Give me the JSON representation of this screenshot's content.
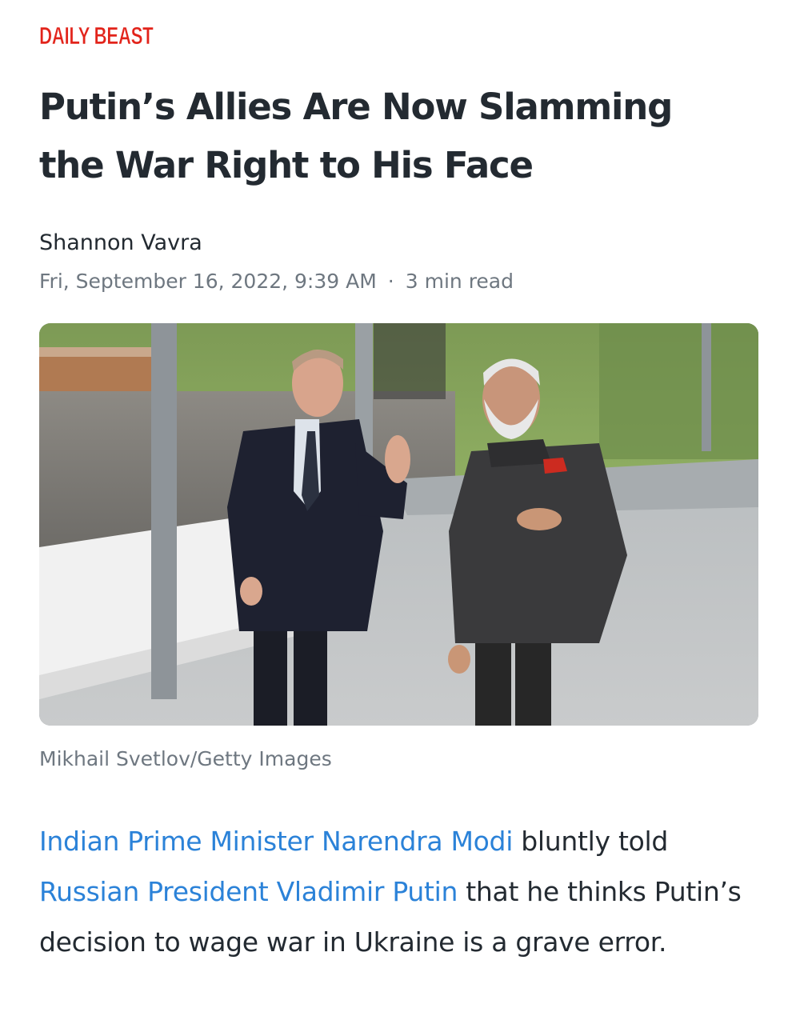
{
  "brand": {
    "logo_text": "DAILY BEAST",
    "color": "#e2231a"
  },
  "article": {
    "headline_line1": "Putin’s Allies Are Now Slamming",
    "headline_line2": "the War Right to His Face",
    "author": "Shannon Vavra",
    "date": "Fri, September 16, 2022, 9:39 AM",
    "separator": "·",
    "read_time": "3 min read",
    "image_caption": "Mikhail Svetlov/Getty Images",
    "body": {
      "link1": "Indian Prime Minister Narendra Modi",
      "text1": " bluntly told ",
      "link2": "Russian President Vladimir Putin",
      "text2": " that he thinks Putin’s decision to wage war in Ukraine is a grave error."
    }
  },
  "colors": {
    "text": "#232a31",
    "muted": "#6e7780",
    "link": "#2b82d8"
  }
}
